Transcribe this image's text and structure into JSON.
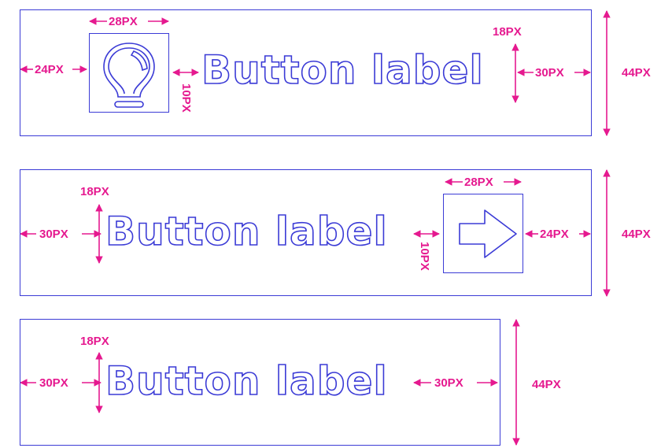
{
  "colors": {
    "outline": "#3b3bd6",
    "dimension": "#e5198f"
  },
  "buttons": [
    {
      "variant": "icon-leading",
      "label": "Button label",
      "icon": "lightbulb-icon",
      "dims": {
        "left_padding": "24PX",
        "icon_width": "28PX",
        "gap": "10PX",
        "text_height": "18PX",
        "right_padding": "30PX",
        "total_height": "44PX"
      }
    },
    {
      "variant": "icon-trailing",
      "label": "Button label",
      "icon": "arrow-right-icon",
      "dims": {
        "left_padding": "30PX",
        "text_height": "18PX",
        "gap": "10PX",
        "icon_width": "28PX",
        "right_padding": "24PX",
        "total_height": "44PX"
      }
    },
    {
      "variant": "text-only",
      "label": "Button label",
      "dims": {
        "left_padding": "30PX",
        "text_height": "18PX",
        "right_padding": "30PX",
        "total_height": "44PX"
      }
    }
  ]
}
